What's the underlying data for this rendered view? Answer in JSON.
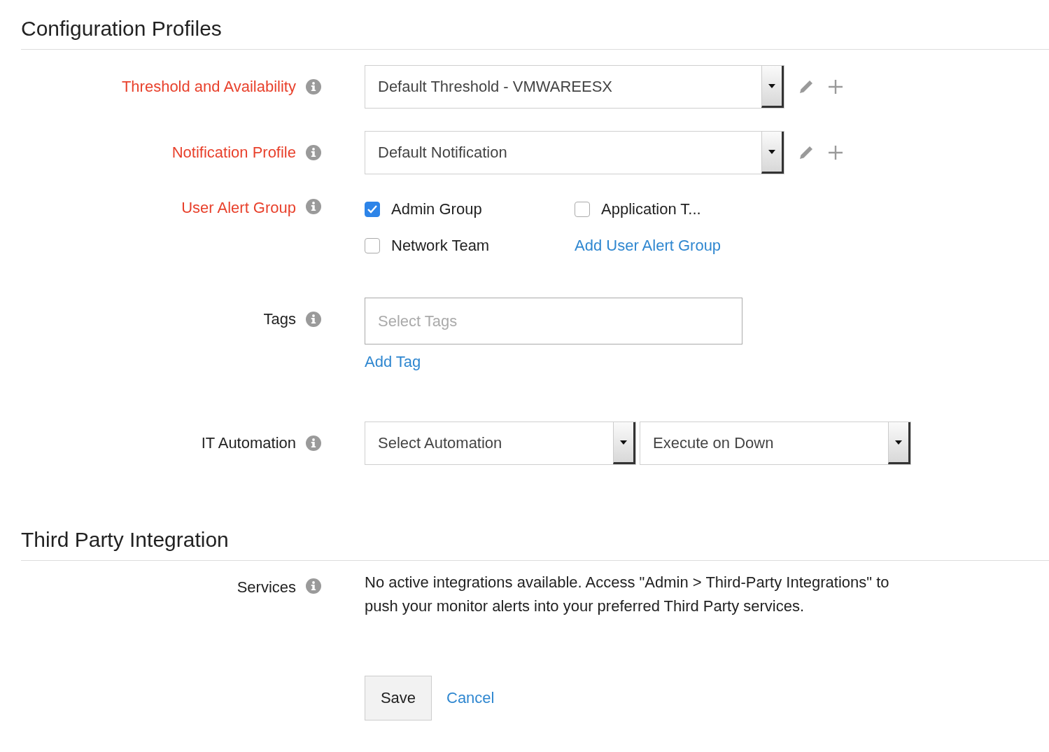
{
  "sections": [
    {
      "title": "Configuration Profiles",
      "rows": [
        {
          "kind": "select",
          "label": "Threshold and Availability",
          "required": true,
          "info": true,
          "value": "Default Threshold - VMWAREESX",
          "actions": true
        },
        {
          "kind": "select",
          "label": "Notification Profile",
          "required": true,
          "info": true,
          "value": "Default Notification",
          "actions": true
        },
        {
          "kind": "checks",
          "label": "User Alert Group",
          "required": true,
          "info": true,
          "options": [
            {
              "label": "Admin Group",
              "checked": true
            },
            {
              "label": "Application T...",
              "checked": false
            },
            {
              "label": "Network Team",
              "checked": false
            }
          ],
          "link": "Add User Alert Group"
        },
        {
          "kind": "tags",
          "label": "Tags",
          "required": false,
          "info": true,
          "placeholder": "Select Tags",
          "link": "Add Tag"
        },
        {
          "kind": "selects",
          "label": "IT Automation",
          "required": false,
          "info": true,
          "values": [
            "Select Automation",
            "Execute on Down"
          ]
        }
      ]
    },
    {
      "title": "Third Party Integration",
      "rows": [
        {
          "kind": "text",
          "label": "Services",
          "required": false,
          "info": true,
          "text": "No active integrations available. Access \"Admin > Third-Party Integrations\" to push your monitor alerts into your preferred Third Party services."
        }
      ]
    }
  ],
  "buttons": {
    "save": "Save",
    "cancel": "Cancel"
  }
}
